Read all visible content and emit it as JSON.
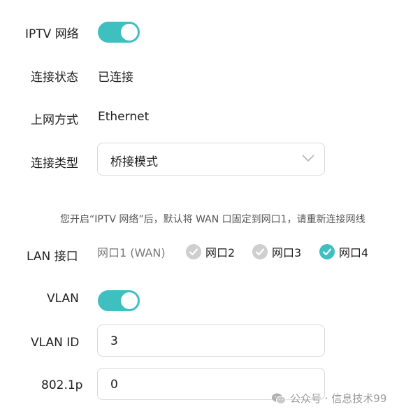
{
  "iptv": {
    "label": "IPTV 网络",
    "enabled": true
  },
  "connection_status": {
    "label": "连接状态",
    "value": "已连接"
  },
  "access_method": {
    "label": "上网方式",
    "value": "Ethernet"
  },
  "connection_type": {
    "label": "连接类型",
    "selected": "桥接模式"
  },
  "hint_text": "您开启“IPTV 网络”后，默认将 WAN 口固定到网口1，请重新连接网线",
  "lan_ports": {
    "label": "LAN 接口",
    "ports": [
      {
        "label": "网口1 (WAN)",
        "state": "fixed"
      },
      {
        "label": "网口2",
        "state": "unchecked"
      },
      {
        "label": "网口3",
        "state": "unchecked"
      },
      {
        "label": "网口4",
        "state": "checked"
      }
    ]
  },
  "vlan": {
    "label": "VLAN",
    "enabled": true
  },
  "vlan_id": {
    "label": "VLAN ID",
    "value": "3"
  },
  "priority": {
    "label": "802.1p",
    "value": "0"
  },
  "watermark": {
    "text": "公众号 · 信息技术99",
    "icon": "wechat-icon"
  },
  "colors": {
    "accent": "#3fbfc0",
    "unchecked": "#cfcfcf",
    "border": "#d9d9d9"
  }
}
